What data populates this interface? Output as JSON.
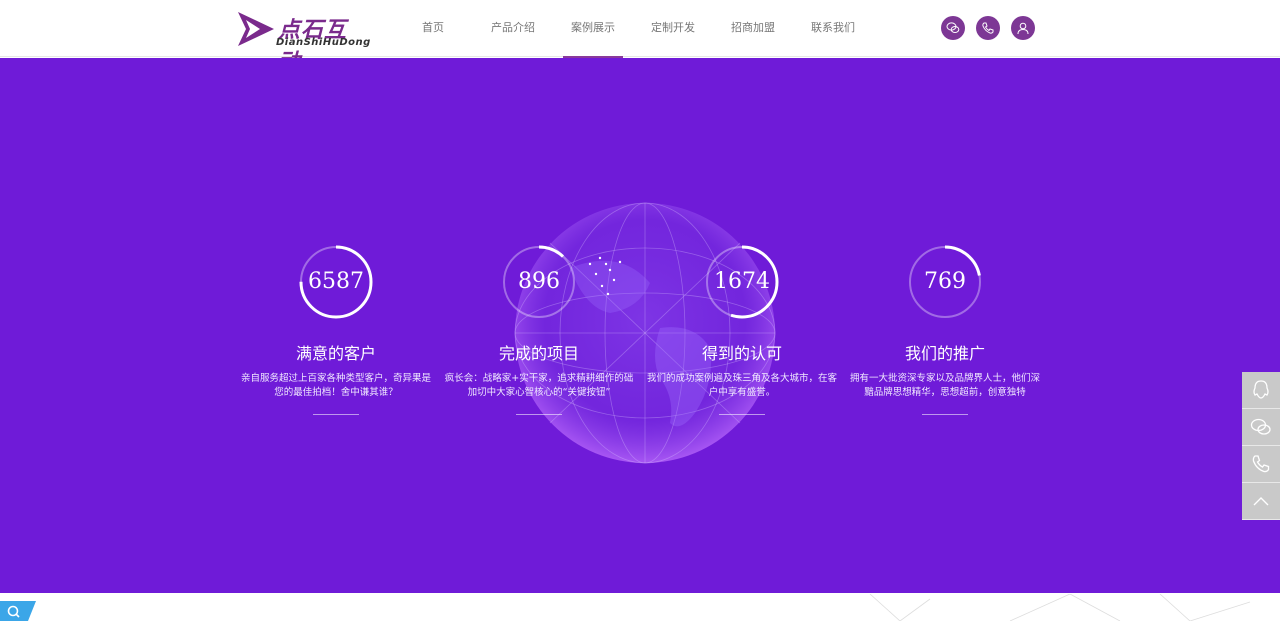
{
  "brand": {
    "name_cn": "点石互动",
    "name_en": "DianShiHuDong",
    "color": "#7a2a8c"
  },
  "nav": {
    "items": [
      {
        "label": "首页"
      },
      {
        "label": "产品介绍"
      },
      {
        "label": "案例展示",
        "active": true
      },
      {
        "label": "定制开发"
      },
      {
        "label": "招商加盟"
      },
      {
        "label": "联系我们"
      }
    ]
  },
  "header_icons": [
    "wechat-icon",
    "phone-icon",
    "user-icon"
  ],
  "hero": {
    "background": "#6f1bd8"
  },
  "stats": [
    {
      "number": "6587",
      "title": "满意的客户",
      "desc": "亲自服务超过上百家各种类型客户，奇异果是您的最佳拍档！舍中谦其谁？",
      "progress": 0.75
    },
    {
      "number": "896",
      "title": "完成的项目",
      "desc": "疯长会：战略家+实干家，追求精耕细作的础加切中大家心智核心的“关键按钮”",
      "progress": 0.12
    },
    {
      "number": "1674",
      "title": "得到的认可",
      "desc": "我们的成功案例遍及珠三角及各大城市，在客户中享有盛誉。",
      "progress": 0.55
    },
    {
      "number": "769",
      "title": "我们的推广",
      "desc": "拥有一大批资深专家以及品牌界人士，他们深黯品牌思想精华，思想超前，创意独特",
      "progress": 0.22
    }
  ],
  "side_float": [
    "qq-icon",
    "wechat-icon",
    "phone-icon",
    "back-to-top-icon"
  ]
}
